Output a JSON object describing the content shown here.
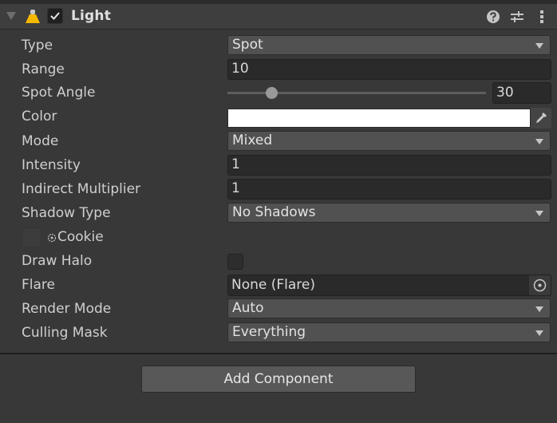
{
  "component": {
    "title": "Light",
    "enabled": true,
    "icons": {
      "foldout": "foldout-expanded-icon",
      "component": "spot-light-icon",
      "help": "help-icon",
      "presets": "presets-icon",
      "menu": "kebab-menu-icon"
    },
    "icon_color": "#f5b800"
  },
  "properties": {
    "type": {
      "label": "Type",
      "value": "Spot"
    },
    "range": {
      "label": "Range",
      "value": "10"
    },
    "spot_angle": {
      "label": "Spot Angle",
      "value": "30",
      "slider_fraction": 0.17
    },
    "color": {
      "label": "Color",
      "value": "#ffffff"
    },
    "mode": {
      "label": "Mode",
      "value": "Mixed"
    },
    "intensity": {
      "label": "Intensity",
      "value": "1"
    },
    "indirect_multiplier": {
      "label": "Indirect Multiplier",
      "value": "1"
    },
    "shadow_type": {
      "label": "Shadow Type",
      "value": "No Shadows"
    },
    "cookie": {
      "label": "Cookie"
    },
    "draw_halo": {
      "label": "Draw Halo",
      "checked": false
    },
    "flare": {
      "label": "Flare",
      "value": "None (Flare)"
    },
    "render_mode": {
      "label": "Render Mode",
      "value": "Auto"
    },
    "culling_mask": {
      "label": "Culling Mask",
      "value": "Everything"
    }
  },
  "footer": {
    "add_component_label": "Add Component"
  }
}
